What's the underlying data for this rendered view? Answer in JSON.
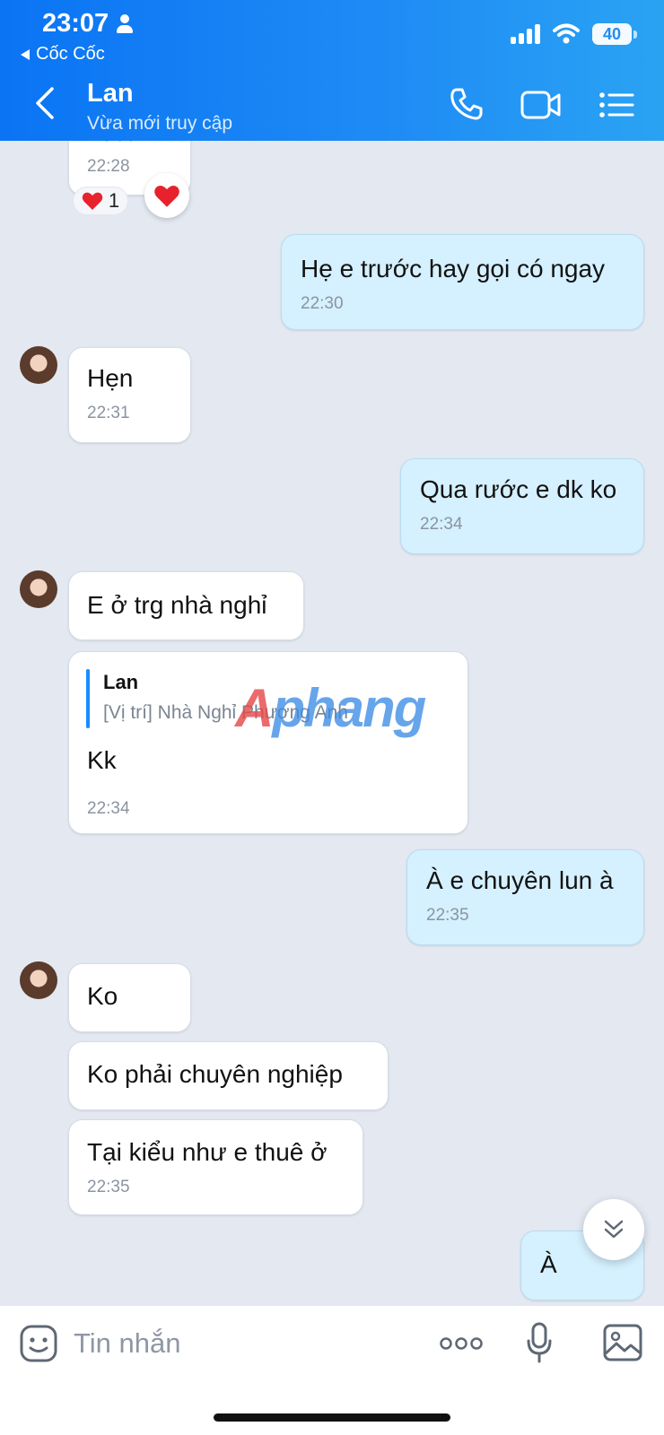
{
  "status_bar": {
    "time": "23:07",
    "back_app": "Cốc Cốc",
    "battery": "40"
  },
  "header": {
    "contact_name": "Lan",
    "contact_status": "Vừa mới truy cập",
    "icons": [
      "back-chevron-icon",
      "phone-icon",
      "video-call-icon",
      "menu-list-icon"
    ]
  },
  "messages": [
    {
      "direction": "in",
      "text": "Test",
      "time": "22:28",
      "reaction": {
        "emoji": "❤️",
        "count": "1"
      }
    },
    {
      "direction": "out",
      "text": "Hẹ e trước hay gọi có ngay",
      "time": "22:30"
    },
    {
      "direction": "in",
      "text": "Hẹn",
      "time": "22:31"
    },
    {
      "direction": "out",
      "text": "Qua rước e dk ko",
      "time": "22:34"
    },
    {
      "direction": "in",
      "text": "E ở trg nhà nghỉ"
    },
    {
      "direction": "in",
      "quote": {
        "name": "Lan",
        "text": "[Vị trí] Nhà Nghỉ Phương Anh"
      },
      "text": "Kk",
      "time": "22:34"
    },
    {
      "direction": "out",
      "text": "À e chuyên lun à",
      "time": "22:35"
    },
    {
      "direction": "in",
      "text": "Ko"
    },
    {
      "direction": "in",
      "text": "Ko phải chuyên nghiệp"
    },
    {
      "direction": "in",
      "text": "Tại kiểu như e thuê ở",
      "time": "22:35"
    },
    {
      "direction": "out",
      "text": "À"
    }
  ],
  "watermark": {
    "first": "A",
    "rest": "phang"
  },
  "input": {
    "placeholder": "Tin nhắn",
    "value": ""
  },
  "colors": {
    "header_gradient_start": "#0a74f4",
    "header_gradient_end": "#2aa3f3",
    "chat_background": "#e3e8f1",
    "outgoing_bubble": "#d5f0fe",
    "incoming_bubble": "#ffffff",
    "reaction_heart": "#e8222d"
  }
}
